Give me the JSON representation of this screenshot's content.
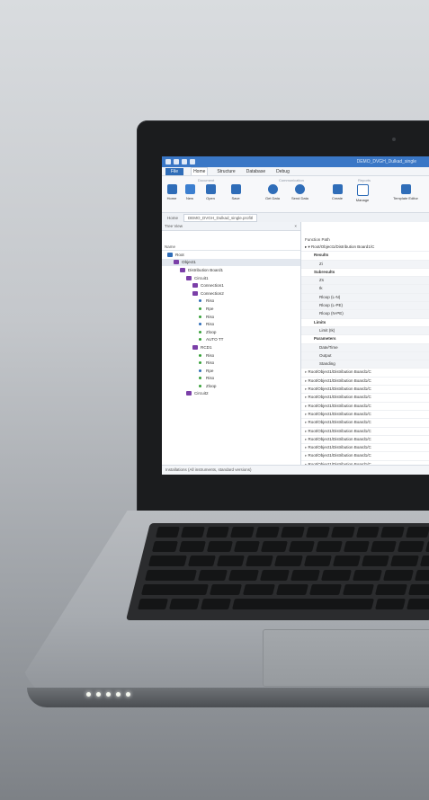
{
  "app": {
    "title": "DEMO_DVGH_Dulkad_single"
  },
  "menu": {
    "file": "File",
    "items": [
      "Home",
      "Structure",
      "Database",
      "Debug"
    ]
  },
  "ribbon": {
    "groups": [
      "Document",
      "Communication",
      "Reports"
    ],
    "buttons": [
      {
        "label": "Home",
        "icon": "home-icon"
      },
      {
        "label": "New",
        "icon": "new-document-icon"
      },
      {
        "label": "Open",
        "icon": "folder-icon"
      },
      {
        "label": "Save",
        "icon": "save-icon"
      },
      {
        "label": "Get Data",
        "icon": "download-icon"
      },
      {
        "label": "Send Data",
        "icon": "upload-icon"
      },
      {
        "label": "Create",
        "icon": "report-icon"
      },
      {
        "label": "Manage",
        "icon": "table-icon"
      },
      {
        "label": "Template Editor",
        "icon": "template-icon"
      }
    ]
  },
  "document": {
    "home": "Home",
    "tab": "DEMO_DVGH_Dulkad_single.profitl"
  },
  "tree": {
    "title": "Tree View",
    "close": "×",
    "column": "Name",
    "nodes": [
      {
        "label": "Root",
        "level": 0,
        "icon": "folder"
      },
      {
        "label": "Object1",
        "level": 1,
        "icon": "object"
      },
      {
        "label": "Distribution Board1",
        "level": 2,
        "icon": "board"
      },
      {
        "label": "Circuit1",
        "level": 3,
        "icon": "board"
      },
      {
        "label": "Connection1",
        "level": 4,
        "icon": "connection"
      },
      {
        "label": "Connection2",
        "level": 4,
        "icon": "connection"
      },
      {
        "label": "Riso",
        "level": 5,
        "icon": "dot"
      },
      {
        "label": "Rpe",
        "level": 5,
        "icon": "dot"
      },
      {
        "label": "Riso",
        "level": 5,
        "icon": "dot"
      },
      {
        "label": "Riso",
        "level": 5,
        "icon": "dot"
      },
      {
        "label": "Zloop",
        "level": 5,
        "icon": "dot"
      },
      {
        "label": "AUTO TT",
        "level": 5,
        "icon": "dot"
      },
      {
        "label": "RCD1",
        "level": 4,
        "icon": "board"
      },
      {
        "label": "Riso",
        "level": 5,
        "icon": "dot"
      },
      {
        "label": "Riso",
        "level": 5,
        "icon": "dot"
      },
      {
        "label": "Rpe",
        "level": 5,
        "icon": "dot"
      },
      {
        "label": "Riso",
        "level": 5,
        "icon": "dot"
      },
      {
        "label": "Zloop",
        "level": 5,
        "icon": "dot"
      },
      {
        "label": "Circuit2",
        "level": 3,
        "icon": "board"
      }
    ]
  },
  "detail": {
    "function_path_label": "Function Path",
    "first_path": "Root/Object1/Distribution Board1/C",
    "fields": [
      {
        "label": "Results",
        "head": true
      },
      {
        "label": "Zi",
        "head": false
      },
      {
        "label": "Subresults",
        "head": true
      },
      {
        "label": "Zs",
        "head": false
      },
      {
        "label": "Ik",
        "head": false
      },
      {
        "label": "Rloop (L-N)",
        "head": false
      },
      {
        "label": "Rloop (L-PE)",
        "head": false
      },
      {
        "label": "Rloop (N-PE)",
        "head": false
      },
      {
        "label": "Limits",
        "head": true
      },
      {
        "label": "Limit (Ik)",
        "head": false
      },
      {
        "label": "Parameters",
        "head": true
      },
      {
        "label": "Date/Time",
        "head": false
      },
      {
        "label": "Output",
        "head": false
      },
      {
        "label": "Standing",
        "head": false
      }
    ],
    "paths": [
      "Root/Object1/Distribution Board1/C",
      "Root/Object1/Distribution Board1/C",
      "Root/Object1/Distribution Board1/C",
      "Root/Object1/Distribution Board1/C",
      "Root/Object1/Distribution Board1/C",
      "Root/Object1/Distribution Board1/C",
      "Root/Object1/Distribution Board1/C",
      "Root/Object1/Distribution Board1/C",
      "Root/Object1/Distribution Board1/C",
      "Root/Object1/Distribution Board1/C",
      "Root/Object1/Distribution Board1/C",
      "Root/Object1/Distribution Board1/C"
    ]
  },
  "status": {
    "text": "Installations (All instruments, standard versions)"
  },
  "colors": {
    "titlebar": "#3a77c6",
    "accent": "#2f6db8",
    "tree_folder": "#2f6db8",
    "tree_object": "#7b3fa8",
    "tree_dot_green": "#38a13a",
    "tree_dot_blue": "#2f6db8"
  }
}
